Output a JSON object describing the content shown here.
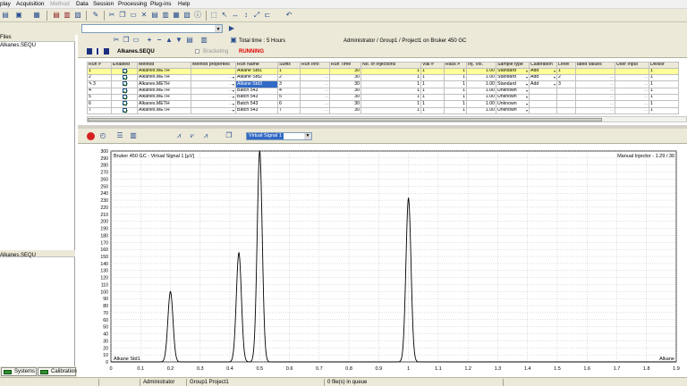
{
  "menu": [
    {
      "label": "play",
      "disabled": false
    },
    {
      "label": "Acquisition",
      "disabled": false
    },
    {
      "label": "Method",
      "disabled": true
    },
    {
      "label": "Data",
      "disabled": false
    },
    {
      "label": "Session",
      "disabled": false
    },
    {
      "label": "Processing",
      "disabled": false
    },
    {
      "label": "Plug-ins",
      "disabled": false
    },
    {
      "label": "Help",
      "disabled": false
    }
  ],
  "left_pane": {
    "top_header": "Files",
    "top_file": "Alkanes.SEQU",
    "bottom_file": "Alkanes.SEQU",
    "tabs": {
      "systems": "Systems",
      "calibration": "Calibration"
    }
  },
  "sequence": {
    "file_name": "Alkanes.SEQU",
    "total_time_label": "Total time :",
    "total_time_value": "5 Hours",
    "context": "Administrator / Group1 / Project1 on Bruker 450 GC",
    "bracketing_label": "Bracketing",
    "status": "RUNNING",
    "status_color": "#e00000",
    "row_highlight_color": "#ffff99"
  },
  "table": {
    "headers": [
      "Run #",
      "Enabled",
      "Method",
      "Method properties",
      "Run Name",
      "Suffix",
      "Run Info",
      "Run Time",
      "No. of Injections",
      "Vial #",
      "Rack #",
      "Inj. Vol.",
      "Sample type",
      "Calibration",
      "Level",
      "lated values",
      "User Input",
      "Divisor"
    ],
    "rows": [
      {
        "run": "1",
        "method": "Alkanes.METH",
        "name": "Alkane Std1",
        "suffix": "1",
        "time": "30",
        "inj": "1",
        "vial": "1",
        "rack": "1",
        "vol": "1.00",
        "type": "Standard",
        "cal": "Add",
        "level": "1",
        "divisor": "1",
        "selected": true,
        "dots": false,
        "marker": ""
      },
      {
        "run": "2",
        "method": "Alkanes.METH",
        "name": "Alkane Std2",
        "suffix": "2",
        "time": "30",
        "inj": "1",
        "vial": "1",
        "rack": "1",
        "vol": "1.00",
        "type": "Standard",
        "cal": "Add",
        "level": "2",
        "divisor": "1",
        "selected": false,
        "dots": true,
        "marker": ""
      },
      {
        "run": "3",
        "method": "Alkanes.METH",
        "name": "Alkane Std3",
        "suffix": "3",
        "time": "30",
        "inj": "1",
        "vial": "1",
        "rack": "1",
        "vol": "1.00",
        "type": "Standard",
        "cal": "Add",
        "level": "3",
        "divisor": "1",
        "selected": false,
        "dots": true,
        "marker": "✎"
      },
      {
        "run": "4",
        "method": "Alkanes.METH",
        "name": "Batch 543",
        "suffix": "4",
        "time": "30",
        "inj": "1",
        "vial": "1",
        "rack": "1",
        "vol": "1.00",
        "type": "Unknown",
        "cal": "",
        "level": "",
        "divisor": "1",
        "selected": false,
        "dots": true,
        "marker": ""
      },
      {
        "run": "5",
        "method": "Alkanes.METH",
        "name": "Batch 543",
        "suffix": "5",
        "time": "30",
        "inj": "1",
        "vial": "1",
        "rack": "1",
        "vol": "1.00",
        "type": "Unknown",
        "cal": "",
        "level": "",
        "divisor": "1",
        "selected": false,
        "dots": true,
        "marker": ""
      },
      {
        "run": "6",
        "method": "Alkanes.METH",
        "name": "Batch 543",
        "suffix": "6",
        "time": "30",
        "inj": "1",
        "vial": "1",
        "rack": "1",
        "vol": "1.00",
        "type": "Unknown",
        "cal": "",
        "level": "",
        "divisor": "1",
        "selected": false,
        "dots": true,
        "marker": ""
      },
      {
        "run": "7",
        "method": "Alkanes.METH",
        "name": "Batch 543",
        "suffix": "7",
        "time": "30",
        "inj": "1",
        "vial": "1",
        "rack": "1",
        "vol": "1.00",
        "type": "Unknown",
        "cal": "",
        "level": "",
        "divisor": "1",
        "selected": false,
        "dots": true,
        "marker": ""
      }
    ]
  },
  "plot_toolbar": {
    "signal_select": "Virtual Signal 1"
  },
  "chart_data": {
    "type": "line",
    "title": "Bruker 450 GC - Virtual Signal 1 [µV]",
    "top_right_label": "Manual Injector - 1.29 / 30",
    "bottom_left_label": "Alkane Std1",
    "bottom_right_label": "Alkane",
    "xlim": [
      0,
      1.9
    ],
    "ylim": [
      0,
      300
    ],
    "xticks": [
      "0",
      "0.1",
      "0.2",
      "0.3",
      "0.4",
      "0.5",
      "0.6",
      "0.7",
      "0.8",
      "0.9",
      "1",
      "1.1",
      "1.2",
      "1.3",
      "1.4",
      "1.5",
      "1.6",
      "1.7",
      "1.8",
      "1.9"
    ],
    "yticks": [
      0,
      10,
      20,
      30,
      40,
      50,
      60,
      70,
      80,
      90,
      100,
      110,
      120,
      130,
      140,
      150,
      160,
      170,
      180,
      190,
      200,
      210,
      220,
      230,
      240,
      250,
      260,
      270,
      280,
      290,
      300
    ],
    "grid": true,
    "peaks": [
      {
        "x": 0.2,
        "height": 100
      },
      {
        "x": 0.43,
        "height": 155
      },
      {
        "x": 0.5,
        "height": 300
      },
      {
        "x": 1.0,
        "height": 233
      }
    ]
  },
  "status_bar": {
    "user": "Administrator",
    "project": "Group1 Project1",
    "queue": "0 file(s) in queue"
  }
}
